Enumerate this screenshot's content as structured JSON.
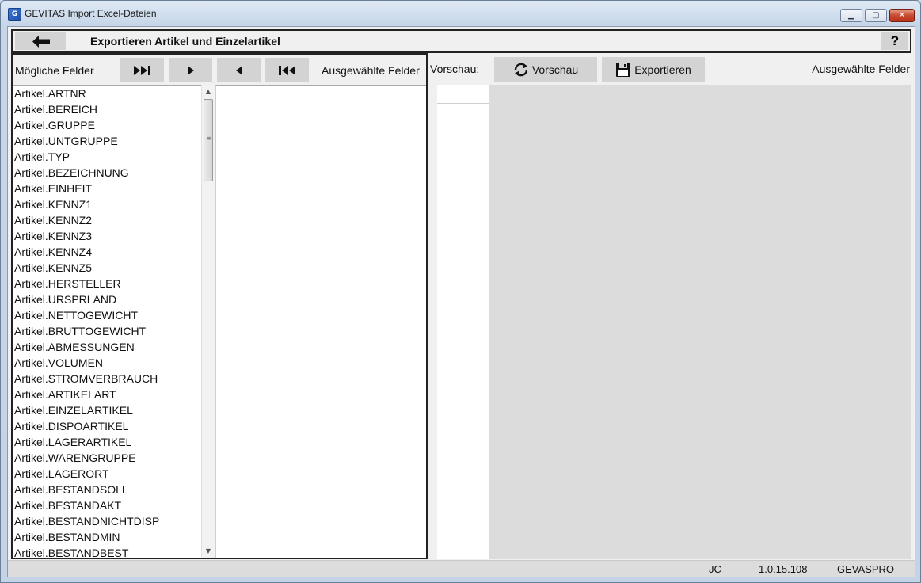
{
  "window": {
    "title": "GEVITAS Import Excel-Dateien",
    "min_glyph": "▁",
    "max_glyph": "▢",
    "close_glyph": "✕"
  },
  "header": {
    "title": "Exportieren Artikel und Einzelartikel",
    "help_label": "?",
    "back_icon": "arrow-left-icon"
  },
  "left_panel": {
    "possible_label": "Mögliche Felder",
    "selected_label": "Ausgewählte Felder",
    "nav_buttons": [
      {
        "name": "move-all-right",
        "icon": "skip-forward-icon"
      },
      {
        "name": "move-right",
        "icon": "play-right-icon"
      },
      {
        "name": "move-left",
        "icon": "play-left-icon"
      },
      {
        "name": "move-all-left",
        "icon": "skip-back-icon"
      }
    ],
    "fields": [
      "Artikel.ARTNR",
      "Artikel.BEREICH",
      "Artikel.GRUPPE",
      "Artikel.UNTGRUPPE",
      "Artikel.TYP",
      "Artikel.BEZEICHNUNG",
      "Artikel.EINHEIT",
      "Artikel.KENNZ1",
      "Artikel.KENNZ2",
      "Artikel.KENNZ3",
      "Artikel.KENNZ4",
      "Artikel.KENNZ5",
      "Artikel.HERSTELLER",
      "Artikel.URSPRLAND",
      "Artikel.NETTOGEWICHT",
      "Artikel.BRUTTOGEWICHT",
      "Artikel.ABMESSUNGEN",
      "Artikel.VOLUMEN",
      "Artikel.STROMVERBRAUCH",
      "Artikel.ARTIKELART",
      "Artikel.EINZELARTIKEL",
      "Artikel.DISPOARTIKEL",
      "Artikel.LAGERARTIKEL",
      "Artikel.WARENGRUPPE",
      "Artikel.LAGERORT",
      "Artikel.BESTANDSOLL",
      "Artikel.BESTANDAKT",
      "Artikel.BESTANDNICHTDISP",
      "Artikel.BESTANDMIN",
      "Artikel.BESTANDBEST"
    ]
  },
  "right_panel": {
    "preview_label": "Vorschau:",
    "preview_button": "Vorschau",
    "export_button": "Exportieren",
    "selected_label": "Ausgewählte Felder"
  },
  "status": {
    "user": "JC",
    "version": "1.0.15.108",
    "database": "GEVASPRO"
  }
}
